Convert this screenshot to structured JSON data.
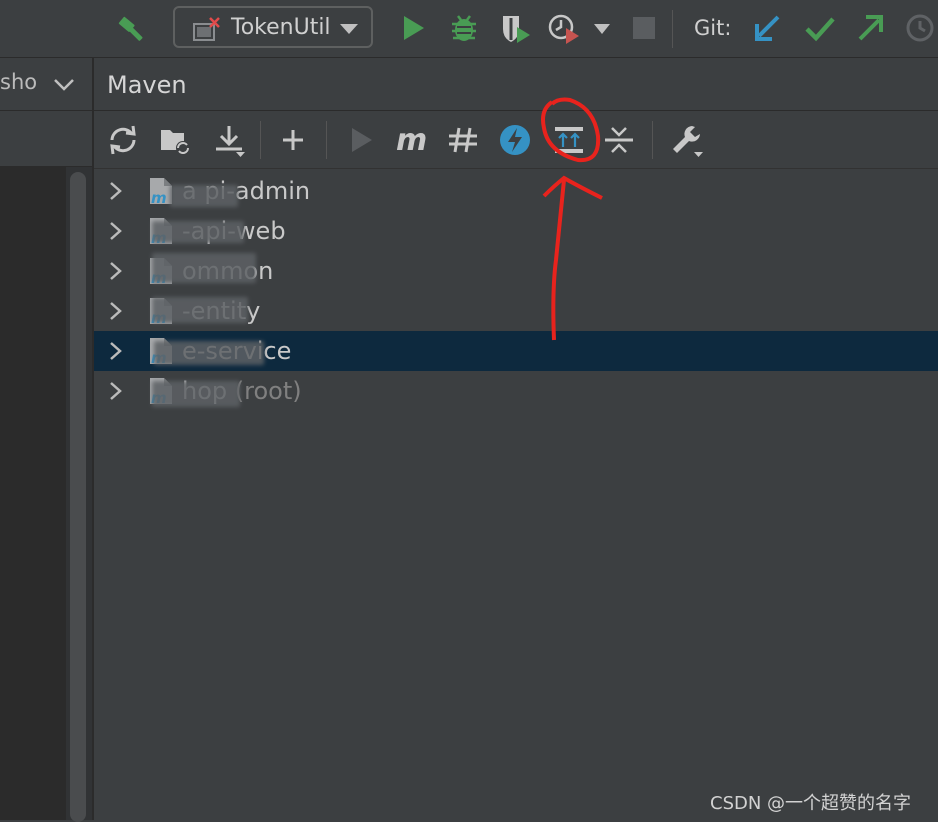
{
  "toolbar": {
    "run_config_label": "TokenUtil",
    "git_label": "Git:"
  },
  "left_panel": {
    "tab_text": "sho"
  },
  "maven": {
    "title": "Maven",
    "modules": [
      {
        "label": "a     pi-admin",
        "suffix": ""
      },
      {
        "label": "      -api-web",
        "suffix": ""
      },
      {
        "label": "      ommon",
        "suffix": ""
      },
      {
        "label": "      -entity",
        "suffix": ""
      },
      {
        "label": "   e-service",
        "suffix": ""
      },
      {
        "label": "      hop",
        "suffix": " (root)"
      }
    ],
    "selected_index": 4
  },
  "annotation": {
    "color": "#e8231d",
    "target": "collapse-all-icon"
  },
  "colors": {
    "run_green": "#499c54",
    "git_blue": "#3592c4",
    "selection": "#0d293e"
  },
  "watermark": "CSDN @一个超赞的名字"
}
